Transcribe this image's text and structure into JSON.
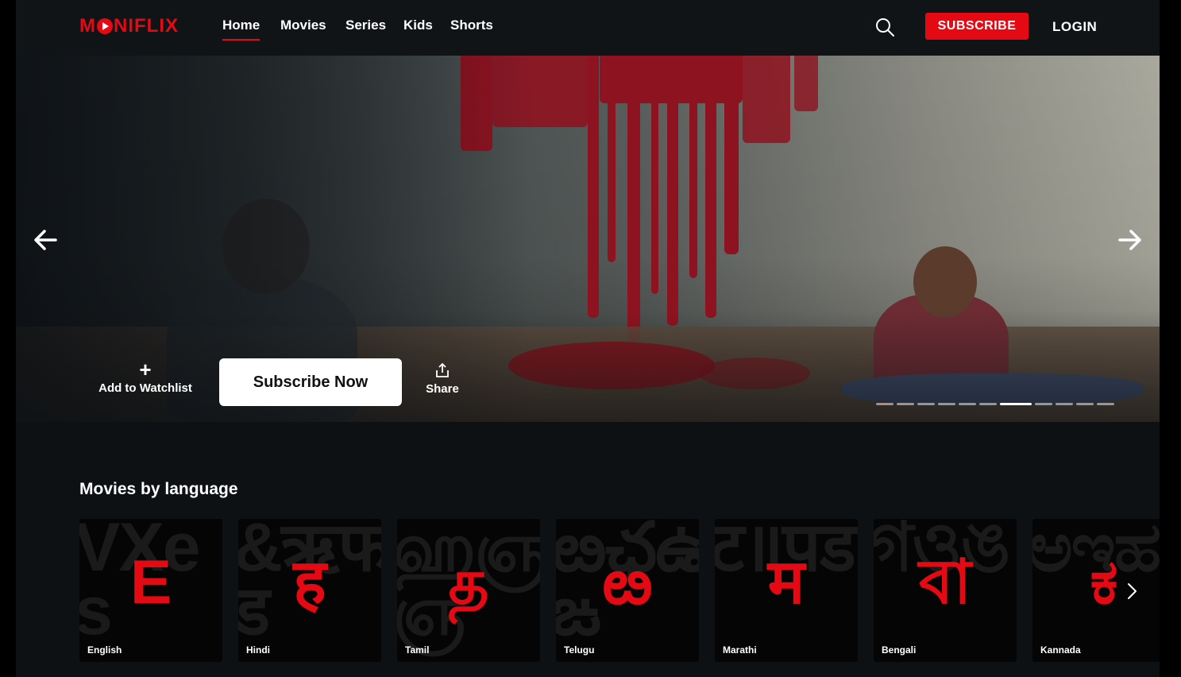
{
  "brand": {
    "logo_pre": "M",
    "logo_post": "NIFLIX",
    "accent_color": "#e50914"
  },
  "nav": {
    "items": [
      {
        "label": "Home",
        "active": true
      },
      {
        "label": "Movies",
        "active": false
      },
      {
        "label": "Series",
        "active": false
      },
      {
        "label": "Kids",
        "active": false
      },
      {
        "label": "Shorts",
        "active": false
      }
    ]
  },
  "header": {
    "search_icon": "search-icon",
    "subscribe_label": "SUBSCRIBE",
    "login_label": "LOGIN"
  },
  "hero": {
    "watchlist_label": "Add to Watchlist",
    "subscribe_now_label": "Subscribe Now",
    "share_label": "Share",
    "carousel": {
      "total": 11,
      "active_index": 6
    }
  },
  "languages": {
    "title": "Movies by language",
    "items": [
      {
        "name": "English",
        "glyph": "E",
        "bg": "VXes"
      },
      {
        "name": "Hindi",
        "glyph": "ह",
        "bg": "&ऋफड"
      },
      {
        "name": "Tamil",
        "glyph": "த",
        "bg": "ஹஞஞ"
      },
      {
        "name": "Telugu",
        "glyph": "ఴ",
        "bg": "ఴఛఉఙ"
      },
      {
        "name": "Marathi",
        "glyph": "म",
        "bg": "ट॥पड"
      },
      {
        "name": "Bengali",
        "glyph": "বা",
        "bg": "গওঙ"
      },
      {
        "name": "Kannada",
        "glyph": "ಕ",
        "bg": "ಅಇಹ"
      }
    ]
  }
}
